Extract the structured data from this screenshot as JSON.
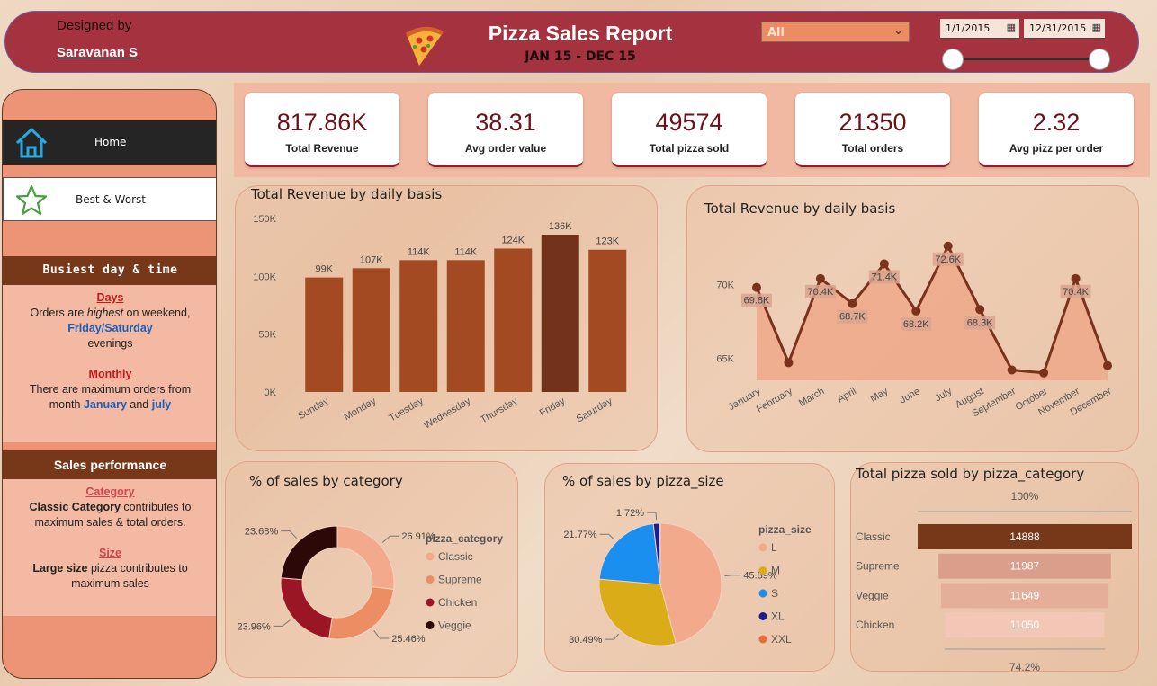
{
  "header": {
    "designed_by": "Designed by",
    "designer": "Saravanan S",
    "title": "Pizza Sales Report",
    "subtitle": "JAN 15 - DEC 15",
    "filter_value": "All",
    "start_date": "1/1/2015",
    "end_date": "12/31/2015"
  },
  "sidebar": {
    "nav": [
      {
        "label": "Home",
        "icon": "home-icon"
      },
      {
        "label": "Best & Worst",
        "icon": "star-icon"
      }
    ],
    "busiest": {
      "heading": "Busiest day & time",
      "days_title": "Days",
      "days_line1_a": "Orders are ",
      "days_line1_b": "highest",
      "days_line1_c": " on weekend,",
      "days_line2": "Friday/Saturday",
      "days_line3": "evenings",
      "monthly_title": "Monthly",
      "monthly_line1": "There are maximum orders from",
      "monthly_line2_a": "month ",
      "monthly_line2_b": "January",
      "monthly_line2_c": " and ",
      "monthly_line2_d": "july"
    },
    "sales": {
      "heading": "Sales performance",
      "category_title": "Category",
      "category_bold": "Classic Category",
      "category_rest1": " contributes to",
      "category_rest2": "maximum sales & total orders.",
      "size_title": "Size",
      "size_bold": "Large size",
      "size_rest1": " pizza contributes to",
      "size_rest2": "maximum sales"
    }
  },
  "kpis": [
    {
      "value": "817.86K",
      "label": "Total Revenue"
    },
    {
      "value": "38.31",
      "label": "Avg order value"
    },
    {
      "value": "49574",
      "label": "Total pizza sold"
    },
    {
      "value": "21350",
      "label": "Total orders"
    },
    {
      "value": "2.32",
      "label": "Avg pizz per order"
    }
  ],
  "colors": {
    "bar": "#a44a22",
    "bar_highlight": "#73331a",
    "line": "#7a321d",
    "area": "#eea88a",
    "pie_classic": "#f2a98c",
    "pie_supreme": "#ec8d63",
    "pie_chicken": "#9a1624",
    "pie_veggie": "#2c0808"
  },
  "chart_data": [
    {
      "type": "bar",
      "title": "Total Revenue by daily basis",
      "categories": [
        "Sunday",
        "Monday",
        "Tuesday",
        "Wednesday",
        "Thursday",
        "Friday",
        "Saturday"
      ],
      "values": [
        99,
        107,
        114,
        114,
        124,
        136,
        123
      ],
      "data_labels": [
        "99K",
        "107K",
        "114K",
        "114K",
        "124K",
        "136K",
        "123K"
      ],
      "y_ticks": [
        "0K",
        "50K",
        "100K",
        "150K"
      ],
      "ylim": [
        0,
        150
      ]
    },
    {
      "type": "area",
      "title": "Total Revenue by daily basis",
      "categories": [
        "January",
        "February",
        "March",
        "April",
        "May",
        "June",
        "July",
        "August",
        "September",
        "October",
        "November",
        "December"
      ],
      "values": [
        69.8,
        64.7,
        70.4,
        68.7,
        71.4,
        68.2,
        72.6,
        68.3,
        64.2,
        64.0,
        70.4,
        64.5
      ],
      "data_labels": [
        "69.8K",
        "",
        "70.4K",
        "68.7K",
        "71.4K",
        "68.2K",
        "72.6K",
        "68.3K",
        "",
        "",
        "70.4K",
        ""
      ],
      "y_ticks": [
        "65K",
        "70K"
      ],
      "ylim": [
        63.5,
        73.5
      ]
    },
    {
      "type": "pie",
      "title": "% of sales by category",
      "legend_title": "pizza_category",
      "labels": [
        "Classic",
        "Supreme",
        "Chicken",
        "Veggie"
      ],
      "values": [
        26.91,
        25.46,
        23.96,
        23.68
      ],
      "data_labels": [
        "26.91%",
        "25.46%",
        "23.96%",
        "23.68%"
      ]
    },
    {
      "type": "pie",
      "title": "% of sales by pizza_size",
      "legend_title": "pizza_size",
      "labels": [
        "L",
        "M",
        "S",
        "XL",
        "XXL"
      ],
      "values": [
        45.89,
        30.49,
        21.77,
        1.72,
        0.12
      ],
      "data_labels": [
        "45.89%",
        "30.49%",
        "21.77%",
        "1.72%",
        ""
      ]
    },
    {
      "type": "bar",
      "title": "Total pizza sold by pizza_category",
      "categories": [
        "Classic",
        "Supreme",
        "Veggie",
        "Chicken"
      ],
      "values": [
        14888,
        11987,
        11649,
        11050
      ],
      "top_label": "100%",
      "bottom_label": "74.2%"
    }
  ]
}
